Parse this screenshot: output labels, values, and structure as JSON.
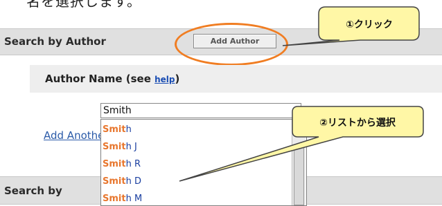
{
  "top_note": "名を選択します。",
  "author_panel": {
    "title": "Search by Author",
    "add_author_label": "Add Author"
  },
  "author_name": {
    "label": "Author Name (see ",
    "help_link": "help",
    "label_end": ")",
    "input_value": "Smith"
  },
  "add_another_link": "Add Another",
  "suggestions": {
    "match_text": "Smit",
    "items": [
      "h",
      "h J",
      "h R",
      "h D",
      "h M"
    ]
  },
  "second_panel": {
    "title": "Search by"
  },
  "callouts": {
    "first": "①クリック",
    "second": "②リストから選択"
  },
  "colors": {
    "highlight_ring": "#f07d22",
    "callout_fill": "#fff7a6",
    "callout_border": "#444444",
    "panel_bar": "#e0e0e0",
    "match_orange": "#e8772e",
    "link_blue": "#2a5aa8"
  }
}
